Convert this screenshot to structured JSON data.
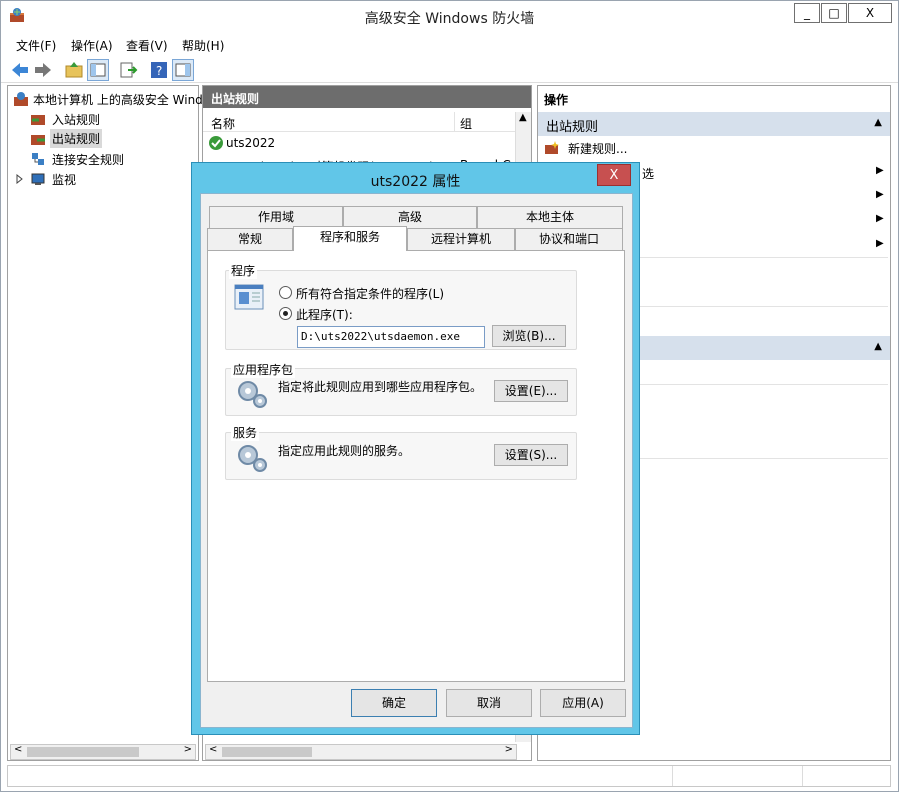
{
  "window": {
    "title": "高级安全 Windows 防火墙",
    "min": "_",
    "max": "□",
    "close": "X"
  },
  "menu": [
    "文件(F)",
    "操作(A)",
    "查看(V)",
    "帮助(H)"
  ],
  "tree": {
    "root": "本地计算机 上的高级安全 Windo",
    "items": [
      "入站规则",
      "出站规则",
      "连接安全规则",
      "监视"
    ]
  },
  "middle": {
    "header": "出站规则",
    "col_name": "名称",
    "col_group": "组",
    "rows": [
      {
        "name": "uts2022",
        "group": ""
      },
      {
        "name": "BranchCache 对等机发现(WSD-Out)",
        "group": "BranchCa"
      }
    ]
  },
  "actions": {
    "header": "操作",
    "section1": "出站规则",
    "new_rule": "新建规则...",
    "filter_fragment": "选"
  },
  "dialog": {
    "title": "uts2022 属性",
    "close": "X",
    "tabs_row1": [
      "作用域",
      "高级",
      "本地主体"
    ],
    "tabs_row2": [
      "常规",
      "程序和服务",
      "远程计算机",
      "协议和端口"
    ],
    "program_group": "程序",
    "radio_all": "所有符合指定条件的程序(L)",
    "radio_this": "此程序(T):",
    "program_path": "D:\\uts2022\\utsdaemon.exe",
    "browse": "浏览(B)...",
    "package_group": "应用程序包",
    "package_desc": "指定将此规则应用到哪些应用程序包。",
    "package_btn": "设置(E)...",
    "service_group": "服务",
    "service_desc": "指定应用此规则的服务。",
    "service_btn": "设置(S)...",
    "ok": "确定",
    "cancel": "取消",
    "apply": "应用(A)"
  },
  "colors": {
    "accent": "#61c6e8",
    "close_red": "#c75050",
    "pane_header": "#6d6d6d",
    "action_header": "#d6e0ec"
  }
}
